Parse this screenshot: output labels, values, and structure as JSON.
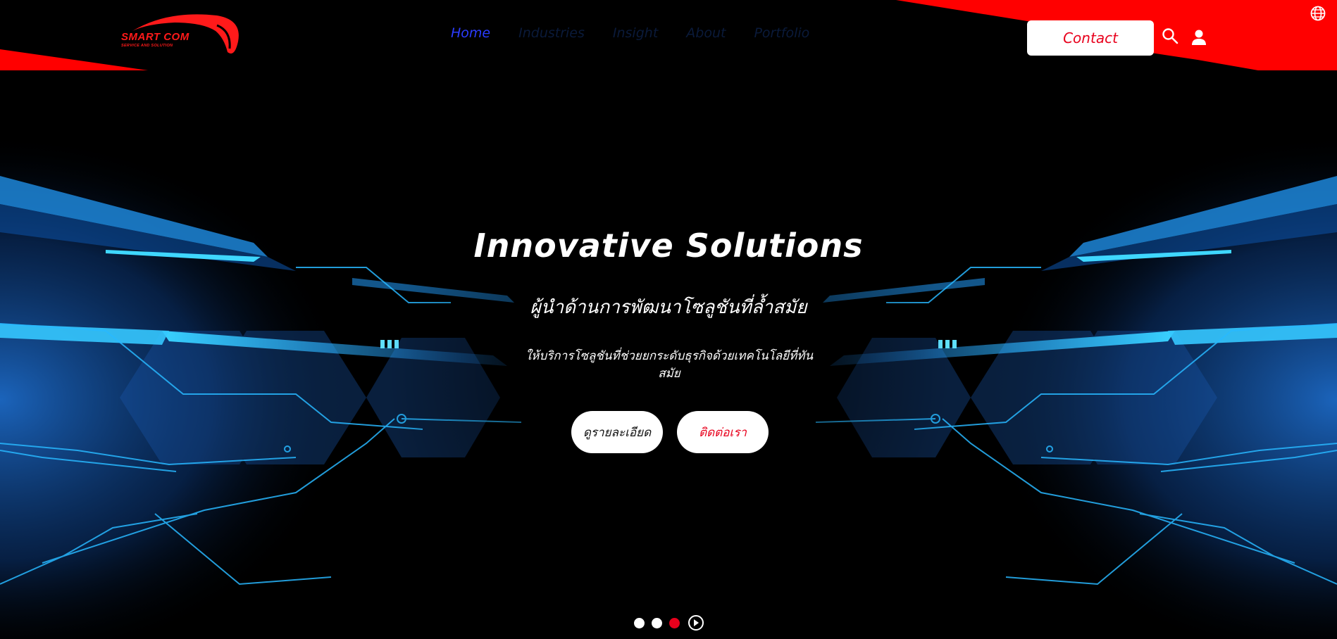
{
  "brand": {
    "name": "SMART COM",
    "tagline": "SERVICE AND SOLUTION",
    "color": "#e8001c"
  },
  "nav": {
    "items": [
      {
        "label": "Home",
        "active": true
      },
      {
        "label": "Industries",
        "active": false
      },
      {
        "label": "Insight",
        "active": false
      },
      {
        "label": "About",
        "active": false
      },
      {
        "label": "Portfolio",
        "active": false
      }
    ]
  },
  "header": {
    "contact_label": "Contact",
    "icons": [
      "search-icon",
      "user-icon",
      "globe-icon"
    ]
  },
  "hero": {
    "title": "Innovative Solutions",
    "subtitle": "ผู้นำด้านการพัฒนาโซลูชันที่ล้ำสมัย",
    "description": "ให้บริการโซลูชันที่ช่วยยกระดับธุรกิจด้วยเทคโนโลยีที่ทันสมัย",
    "details_button": "ดูรายละเอียด",
    "contact_button": "ติดต่อเรา"
  },
  "carousel": {
    "slide_count": 3,
    "active_index": 2
  },
  "colors": {
    "accent_red": "#ff0000",
    "nav_active": "#2b3cff",
    "nav_inactive": "#0a1a3a",
    "circuit_cyan": "#1ec8ff"
  }
}
